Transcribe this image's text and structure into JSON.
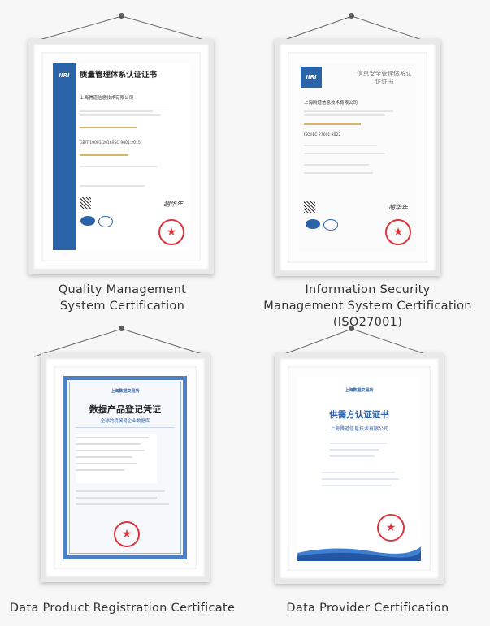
{
  "items": [
    {
      "caption_lines": [
        "Quality Management",
        "System Certification"
      ],
      "cert": {
        "title": "质量管理体系认证证书",
        "company": "上海腾道信息技术有限公司",
        "standard": "GB/T 19001-2016/ISO 9001:2015",
        "signature": "胡华年",
        "logo_text": "IIRI"
      }
    },
    {
      "caption_lines": [
        "Information Security",
        "Management System Certification",
        "(ISO27001)"
      ],
      "cert": {
        "title": "信息安全管理体系认证证书",
        "company": "上海腾道信息技术有限公司",
        "standard": "ISO/IEC 27001:2022",
        "signature": "胡华年",
        "logo_text": "IIRI"
      }
    },
    {
      "caption_lines": [
        "Data Product Registration Certificate"
      ],
      "cert": {
        "issuer": "上海数据交易所",
        "title": "数据产品登记凭证",
        "subtitle": "全球跨境贸易企业数据库"
      }
    },
    {
      "caption_lines": [
        "Data Provider Certification"
      ],
      "cert": {
        "issuer": "上海数据交易所",
        "title": "供需方认证证书",
        "company": "上海腾道信息技术有限公司"
      }
    }
  ]
}
